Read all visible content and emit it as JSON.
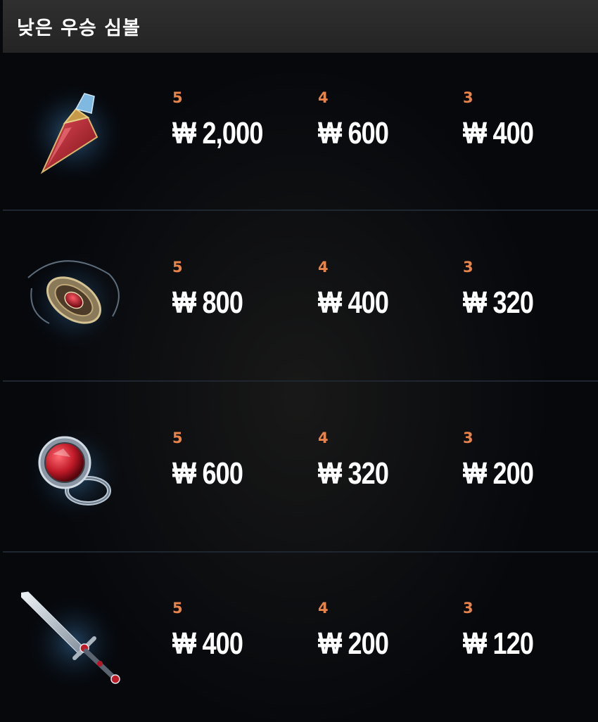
{
  "header": {
    "title": "낮은 우승 심볼"
  },
  "symbols": [
    {
      "icon": "potion-bottle-icon",
      "pays": [
        {
          "count": "5",
          "amount": "₩ 2,000"
        },
        {
          "count": "4",
          "amount": "₩ 600"
        },
        {
          "count": "3",
          "amount": "₩ 400"
        }
      ]
    },
    {
      "icon": "ruby-amulet-icon",
      "pays": [
        {
          "count": "5",
          "amount": "₩ 800"
        },
        {
          "count": "4",
          "amount": "₩ 400"
        },
        {
          "count": "3",
          "amount": "₩ 320"
        }
      ]
    },
    {
      "icon": "ruby-ring-icon",
      "pays": [
        {
          "count": "5",
          "amount": "₩ 600"
        },
        {
          "count": "4",
          "amount": "₩ 320"
        },
        {
          "count": "3",
          "amount": "₩ 200"
        }
      ]
    },
    {
      "icon": "ruby-dagger-icon",
      "pays": [
        {
          "count": "5",
          "amount": "₩ 400"
        },
        {
          "count": "4",
          "amount": "₩ 200"
        },
        {
          "count": "3",
          "amount": "₩ 120"
        }
      ]
    }
  ],
  "colors": {
    "count": "#e8834a",
    "amount": "#ffffff",
    "header_bg": "#2b2b2b",
    "divider": "#1f2630"
  }
}
